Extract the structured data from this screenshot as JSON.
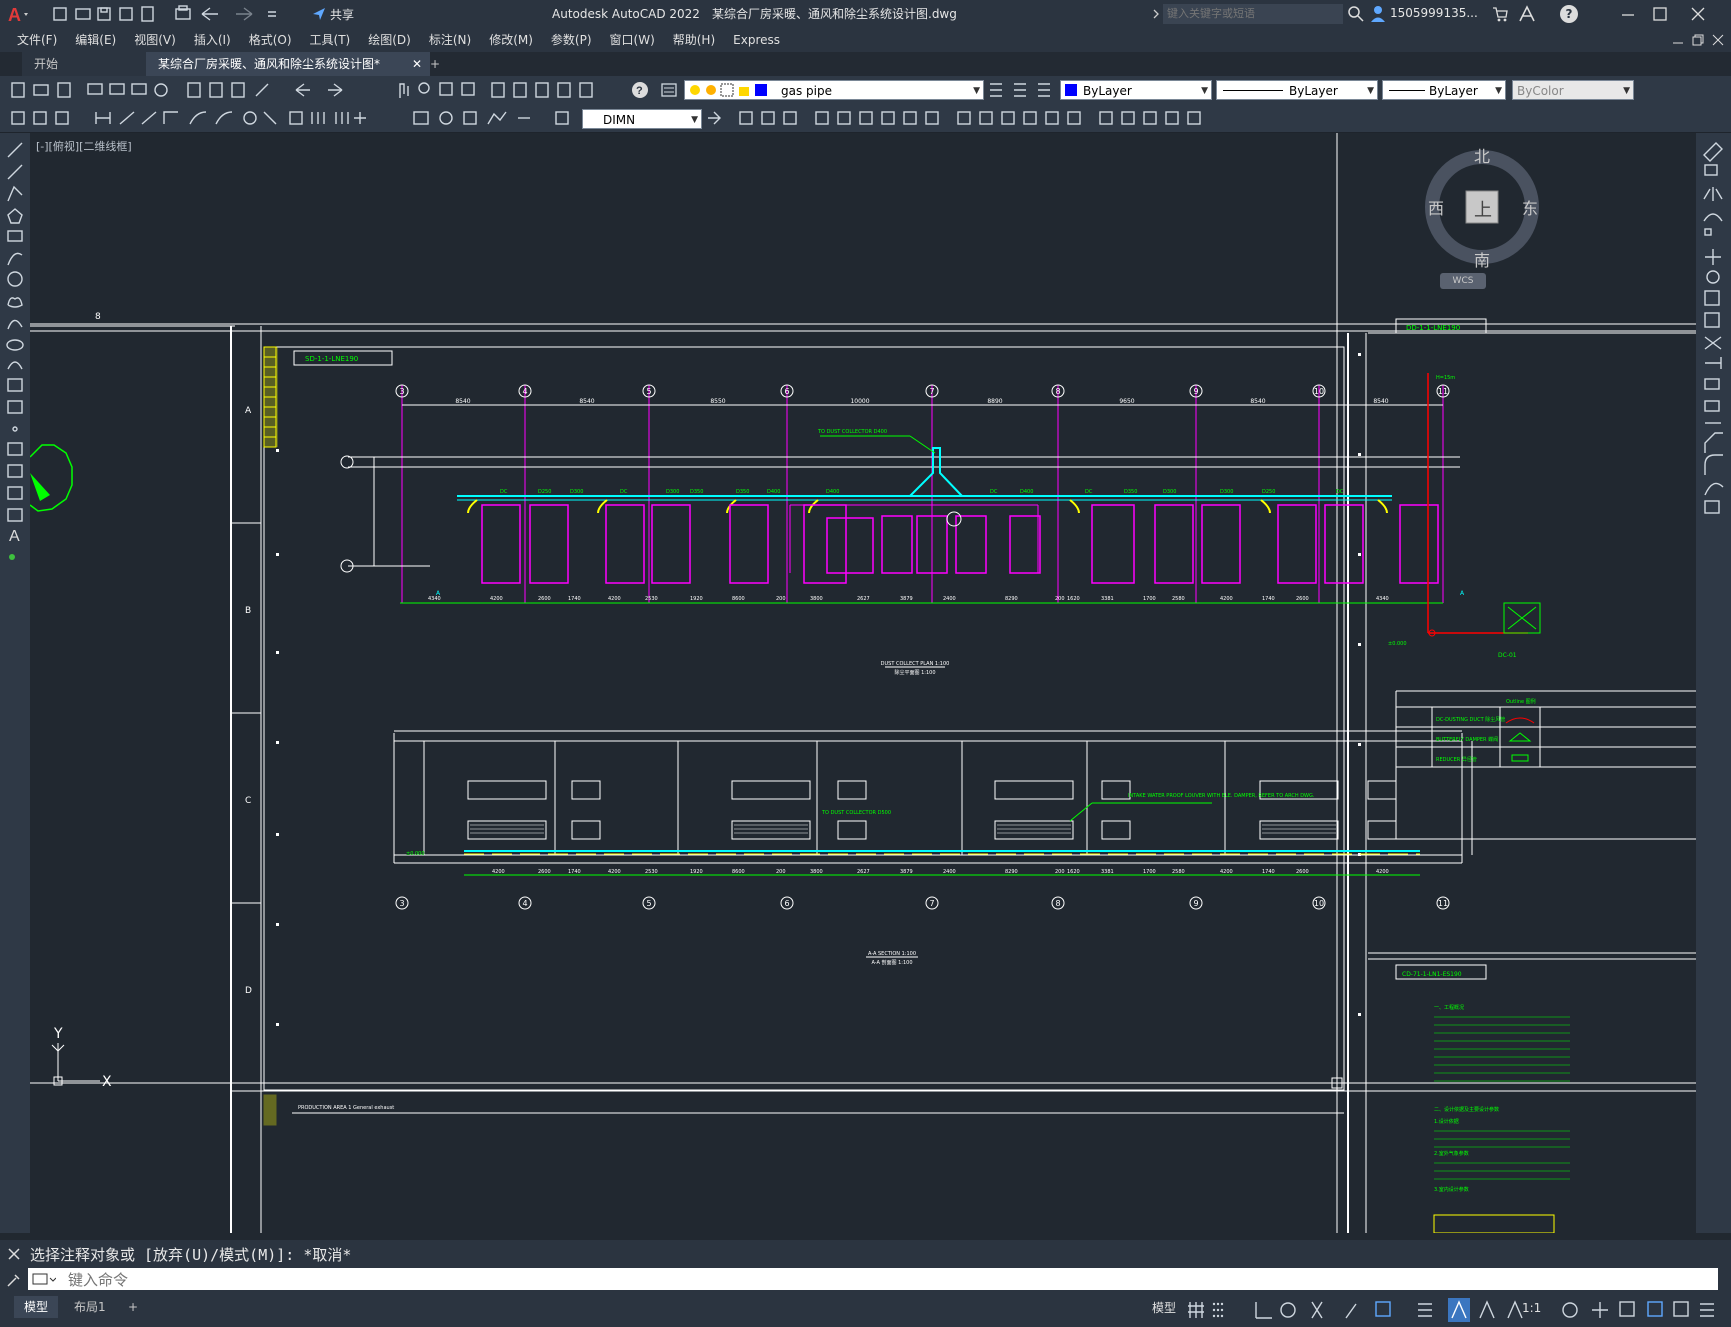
{
  "titlebar": {
    "app_title": "Autodesk AutoCAD 2022",
    "file_name": "某综合厂房采暖、通风和除尘系统设计图.dwg",
    "share_label": "共享",
    "search_placeholder": "键入关键字或短语",
    "user_name": "1505999135...",
    "help_label": "?"
  },
  "menubar": {
    "items": [
      "文件(F)",
      "编辑(E)",
      "视图(V)",
      "插入(I)",
      "格式(O)",
      "工具(T)",
      "绘图(D)",
      "标注(N)",
      "修改(M)",
      "参数(P)",
      "窗口(W)",
      "帮助(H)",
      "Express"
    ]
  },
  "tabs": {
    "start": "开始",
    "drawing": "某综合厂房采暖、通风和除尘系统设计图*",
    "add": "+"
  },
  "toolbar": {
    "layer_name": "gas pipe",
    "color": "ByLayer",
    "linetype": "ByLayer",
    "lineweight": "ByLayer",
    "plotstyle": "ByColor",
    "dimstyle": "DIMN"
  },
  "viewport": {
    "label": "[-][俯视][二维线框]",
    "viewcube_north": "北",
    "viewcube_south": "南",
    "viewcube_east": "东",
    "viewcube_west": "西",
    "viewcube_top": "上",
    "wcs": "WCS",
    "ucs_y": "Y",
    "ucs_x": "X"
  },
  "drawing": {
    "frame_row_labels": [
      "A",
      "B",
      "C",
      "D"
    ],
    "frame_top_mark": "8",
    "axis_numbers": [
      "3",
      "4",
      "5",
      "6",
      "7",
      "8",
      "9",
      "10",
      "11"
    ],
    "top_dims": [
      "8540",
      "8540",
      "8550",
      "10000",
      "8890",
      "9650",
      "8540",
      "8540"
    ],
    "bottom_dims": [
      "4340",
      "4200",
      "2600",
      "1740",
      "4200",
      "2530",
      "1920",
      "8600",
      "200",
      "3800",
      "2627",
      "3879",
      "2400",
      "8290",
      "200",
      "1620",
      "3381",
      "1700",
      "2580",
      "4200",
      "1740",
      "2600",
      "4340"
    ],
    "section_dims": [
      "4200",
      "2600",
      "1740",
      "4200",
      "2530",
      "1920",
      "8600",
      "200",
      "3800",
      "2627",
      "3879",
      "2400",
      "8290",
      "200",
      "1620",
      "3381",
      "1700",
      "2580",
      "4200",
      "1740",
      "2600",
      "4200"
    ],
    "plan_title": "DUST COLLECT PLAN 1:100",
    "plan_title_cn": "除尘平面图 1:100",
    "section_title": "A-A SECTION 1:100",
    "section_title_cn": "A-A 剖面图 1:100",
    "note_collector_1": "TO DUST COLLECTOR D400",
    "note_collector_2": "TO DUST COLLECTOR D500",
    "note_intake": "INTAKE WATER PROOF LOUVER WITH ELE. DAMPER, REFER TO ARCH DWG.",
    "level_mark": "±0.000",
    "right_panel_title_1": "DD-1-1-LNE190",
    "right_panel_title_2": "SD-1-1-LNE190",
    "right_panel_title_3": "CD-71-1-LN1-ES190",
    "legend_items": [
      "DC-DUSTING DUCT 除尘风管",
      "BUTTERFLY DAMPER 蝶阀",
      "REDUCER 异径管"
    ],
    "legend_header": "Outline 图例",
    "dc_label": "DC-01",
    "height_label": "H=15m",
    "bottom_panel_text": "PRODUCTION AREA   1 General exhaust",
    "notes_lines": [
      "一、工程概况",
      "二、设计依据及主要设计参数",
      "1.设计依据",
      "2.室外气象参数",
      "3.室内设计参数"
    ]
  },
  "command": {
    "history": "选择注释对象或 [放弃(U)/模式(M)]: *取消*",
    "placeholder": "键入命令"
  },
  "status": {
    "model_tab": "模型",
    "layout_tab": "布局1",
    "add_tab": "+",
    "model_space": "模型",
    "scale": "1:1"
  },
  "colors": {
    "magenta": "#ff00ff",
    "green": "#00ff00",
    "cyan": "#00ffff",
    "yellow": "#ffff00",
    "white": "#ffffff",
    "bg": "#212830"
  }
}
